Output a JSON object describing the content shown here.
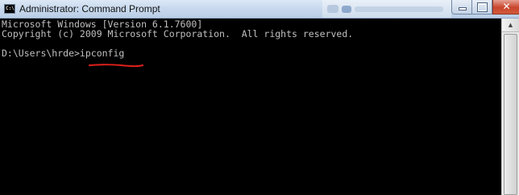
{
  "window": {
    "title": "Administrator: Command Prompt",
    "icon": "cmd-icon",
    "icon_text": "C:\\"
  },
  "title_buttons": {
    "minimize_icon": "minimize-icon",
    "maximize_icon": "maximize-icon",
    "close_icon": "close-icon",
    "close_glyph": "✕"
  },
  "console": {
    "lines": [
      "Microsoft Windows [Version 6.1.7600]",
      "Copyright (c) 2009 Microsoft Corporation.  All rights reserved.",
      "D:\\Users\\hrde>ipconfig"
    ],
    "text_color": "#c0c0c0",
    "background_color": "#000000",
    "annotation_color": "#e0201a"
  },
  "scrollbar": {
    "up_arrow_icon": "scroll-up-arrow-icon",
    "up_arrow_glyph": "▲"
  }
}
